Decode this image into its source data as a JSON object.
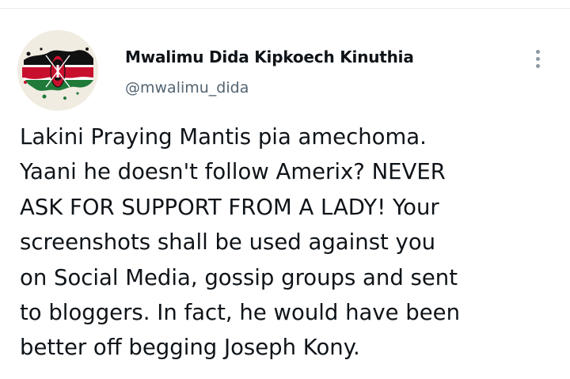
{
  "author": {
    "name": "Mwalimu Dida Kipkoech Kinuthia",
    "handle": "@mwalimu_dida",
    "avatar_icon": "kenya-flag-splash-avatar"
  },
  "more_icon": "vertical-ellipsis-icon",
  "tweet": {
    "lines": [
      "Lakini Praying Mantis pia amechoma.",
      "Yaani he doesn't follow Amerix? NEVER",
      "ASK FOR SUPPORT FROM A LADY! Your",
      "screenshots shall be used against you",
      "on Social Media, gossip groups and sent",
      "to bloggers. In fact, he would have been",
      "better off begging Joseph Kony."
    ]
  },
  "colors": {
    "name": "#0f1419",
    "handle": "#536471",
    "icon": "#8b98a5",
    "flag_red": "#c8102e",
    "flag_green": "#1f7a3a",
    "flag_black": "#111111"
  }
}
